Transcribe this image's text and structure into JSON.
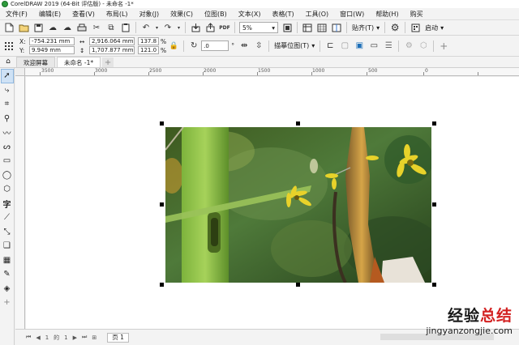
{
  "window": {
    "title": "CorelDRAW 2019 (64-Bit 评估版) - 未命名 -1*"
  },
  "menu": [
    "文件(F)",
    "编辑(E)",
    "查看(V)",
    "布局(L)",
    "对象(J)",
    "效果(C)",
    "位图(B)",
    "文本(X)",
    "表格(T)",
    "工具(O)",
    "窗口(W)",
    "帮助(H)",
    "购买"
  ],
  "toolbar": {
    "zoom_value": "5%",
    "snap_label": "贴齐(T)",
    "launch_label": "启动"
  },
  "property_bar": {
    "x_label": "X:",
    "y_label": "Y:",
    "x_value": "-754.231 mm",
    "y_value": "9.949 mm",
    "width_value": "2,916.064 mm",
    "height_value": "1,707.877 mm",
    "scale_x": "137.8",
    "scale_y": "121.0",
    "percent": "%",
    "rotation_value": ".0",
    "trace_label": "描摹位图(T)"
  },
  "tabs": {
    "welcome": "欢迎屏幕",
    "document": "未命名 -1*"
  },
  "ruler": {
    "labels": [
      "3500",
      "3000",
      "2500",
      "2000",
      "1500",
      "1000",
      "500",
      "0"
    ]
  },
  "page_nav": {
    "current": "1",
    "separator": "的",
    "total": "1",
    "page_tab": "页 1"
  },
  "watermark": {
    "line1_a": "经验",
    "line1_b": "总结",
    "url": "jingyanzongjie.com"
  }
}
